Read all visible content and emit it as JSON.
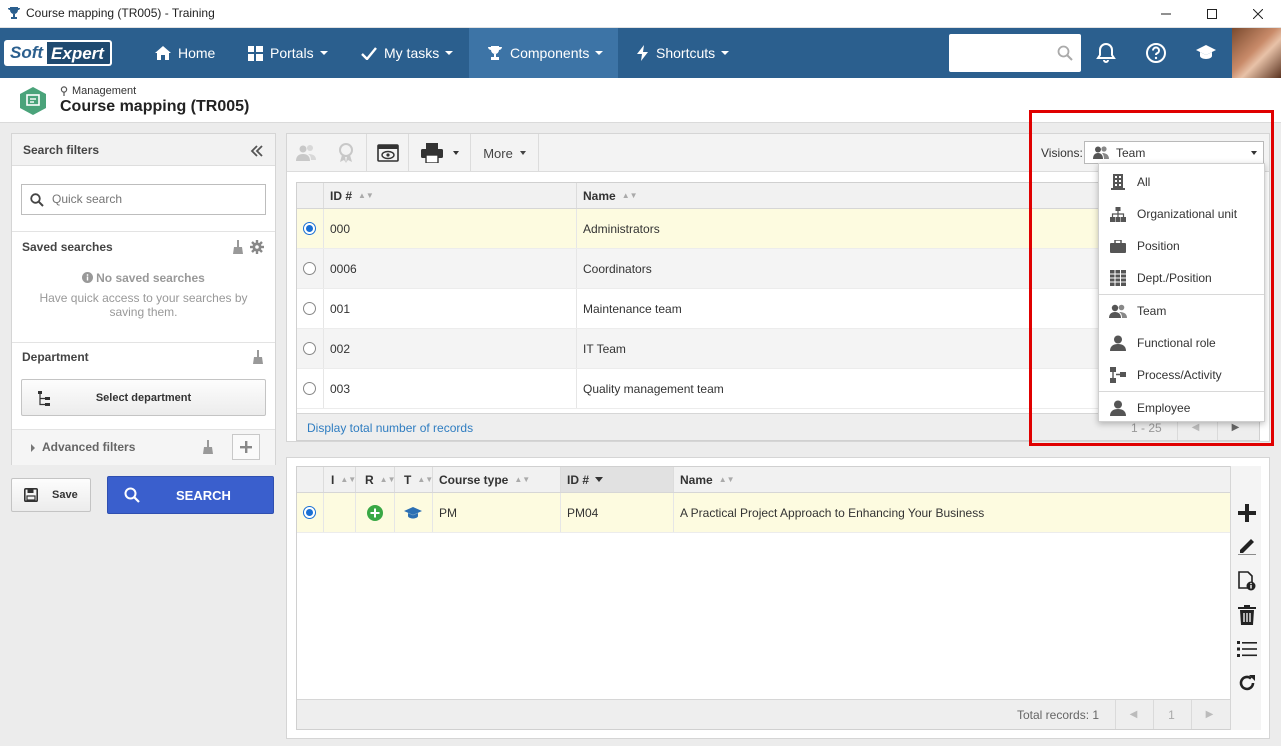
{
  "window": {
    "title": "Course mapping (TR005) - Training"
  },
  "nav": {
    "logo_soft": "Soft",
    "logo_expert": "Expert",
    "items": [
      {
        "label": "Home"
      },
      {
        "label": "Portals"
      },
      {
        "label": "My tasks"
      },
      {
        "label": "Components"
      },
      {
        "label": "Shortcuts"
      }
    ],
    "search_placeholder": ""
  },
  "header": {
    "breadcrumb": "Management",
    "title": "Course mapping (TR005)"
  },
  "filters": {
    "title": "Search filters",
    "quick_search_placeholder": "Quick search",
    "saved_searches_label": "Saved searches",
    "no_saved_title": "No saved searches",
    "no_saved_text": "Have quick access to your searches by saving them.",
    "department_label": "Department",
    "select_department": "Select department",
    "advanced_filters": "Advanced filters",
    "save_label": "Save",
    "search_label": "SEARCH"
  },
  "toolbar": {
    "more_label": "More",
    "visions_label": "Visions:",
    "visions_selected": "Team"
  },
  "visions_menu": {
    "items": [
      "All",
      "Organizational unit",
      "Position",
      "Dept./Position",
      "Team",
      "Functional role",
      "Process/Activity",
      "Employee"
    ]
  },
  "team_grid": {
    "columns": [
      "ID #",
      "Name"
    ],
    "rows": [
      {
        "id": "000",
        "name": "Administrators",
        "selected": true
      },
      {
        "id": "0006",
        "name": "Coordinators",
        "selected": false
      },
      {
        "id": "001",
        "name": "Maintenance team",
        "selected": false
      },
      {
        "id": "002",
        "name": "IT Team",
        "selected": false
      },
      {
        "id": "003",
        "name": "Quality management team",
        "selected": false
      }
    ],
    "footer_link": "Display total number of records",
    "pagination": "1 - 25"
  },
  "course_grid": {
    "columns": [
      "I",
      "R",
      "T",
      "Course type",
      "ID #",
      "Name"
    ],
    "rows": [
      {
        "course_type": "PM",
        "id": "PM04",
        "name": "A Practical Project Approach to Enhancing Your Business"
      }
    ],
    "total_records": "Total records: 1",
    "page": "1"
  },
  "colors": {
    "nav_bg": "#2b5f8e",
    "nav_active": "#3d74a6",
    "search_button": "#3a5fcd",
    "selected_row": "#fdfbe0",
    "highlight_box": "#e00000"
  }
}
